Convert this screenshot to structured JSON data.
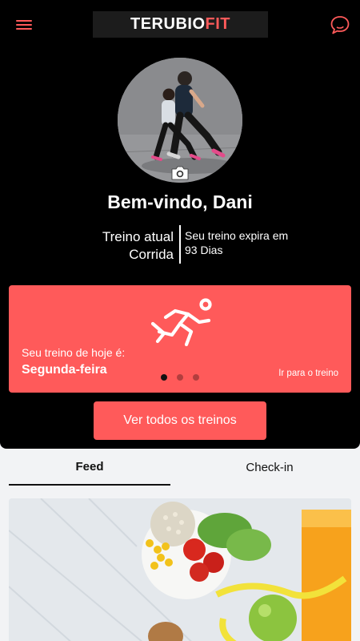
{
  "header": {
    "logo_part1": "TERUBIO",
    "logo_part2": "FIT",
    "menu_icon": "hamburger-menu-icon",
    "chat_icon": "chat-bubble-icon",
    "accent_color": "#ff5a5a"
  },
  "profile": {
    "welcome": "Bem-vindo, Dani",
    "camera_icon": "camera-icon",
    "current_plan_label": "Treino atual",
    "current_plan_value": "Corrida",
    "expires_line1": "Seu treino expira em",
    "expires_line2": "93 Dias"
  },
  "today_card": {
    "icon": "running-person-icon",
    "label": "Seu treino de hoje é:",
    "day": "Segunda-feira",
    "link": "Ir para o treino",
    "page_count": 3,
    "active_page": 1
  },
  "all_workouts_button": "Ver todos os treinos",
  "tabs": [
    {
      "label": "Feed",
      "active": true
    },
    {
      "label": "Check-in",
      "active": false
    }
  ]
}
